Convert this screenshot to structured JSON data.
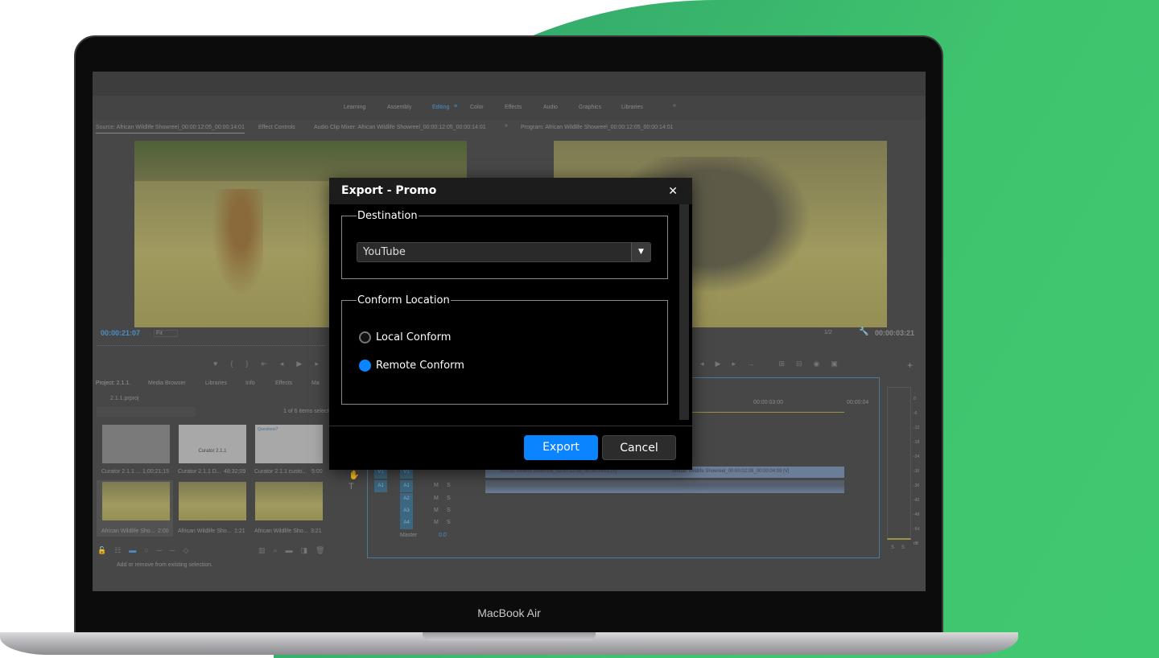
{
  "device_label": "MacBook Air",
  "workspaces": {
    "items": [
      "Learning",
      "Assembly",
      "Editing",
      "Color",
      "Effects",
      "Audio",
      "Graphics",
      "Libraries"
    ],
    "active": "Editing"
  },
  "source_panel": {
    "tabs": [
      "Source: African Wildlife Showreel_00:00:12:05_00:00:14:01",
      "Effect Controls",
      "Audio Clip Mixer: African Wildlife Showreel_00:00:12:05_00:00:14:01"
    ],
    "timecode": "00:00:21:07",
    "zoom": "Fit"
  },
  "program_panel": {
    "title": "Program: African Wildlife Showreel_00:00:12:05_00:00:14:01",
    "resolution": "1/2",
    "timecode": "00:00:03:21"
  },
  "project_panel": {
    "tabs": [
      "Project: 2.1.1.",
      "Media Browser",
      "Libraries",
      "Info",
      "Effects",
      "Ma"
    ],
    "project_file": "2.1.1.prproj",
    "selection_count": "1 of 6 items selected",
    "items": [
      {
        "name": "Curator 2.1.1 ...",
        "duration": "1;00;21;15"
      },
      {
        "name": "Curator 2.1.1 D...",
        "duration": "48;32;09",
        "thumb_text": "Curator 2.1.1"
      },
      {
        "name": "Curator 2.1.1 custo...",
        "duration": "5:00",
        "thumb_text": "Questions?"
      },
      {
        "name": "African Wildlife Sho...",
        "duration": "2:00"
      },
      {
        "name": "African Wildlife Sho...",
        "duration": "1:21"
      },
      {
        "name": "African Wildlife Sho...",
        "duration": "3:21"
      }
    ]
  },
  "timeline": {
    "ruler": [
      "00:00:03:00",
      "00:00:04"
    ],
    "clips": [
      "African Wildlife Showreel_00:00:12:05_00:00:14:01 [V]",
      "African Wildlife Showreel_00:00:02:09_00:00:04:09 [V]"
    ],
    "tracks": [
      {
        "src": "V1",
        "dst": "V1"
      },
      {
        "src": "A1",
        "dst": "A1"
      },
      {
        "src": "",
        "dst": "A2"
      },
      {
        "src": "",
        "dst": "A3"
      },
      {
        "src": "",
        "dst": "A4"
      }
    ],
    "mute": "M",
    "solo": "S",
    "master_label": "Master",
    "master_value": "0.0"
  },
  "audio_meter": {
    "scale": [
      "0",
      "-6",
      "-12",
      "-18",
      "-24",
      "-30",
      "-36",
      "-42",
      "-48",
      "-54",
      "dB"
    ],
    "solo": [
      "S",
      "S"
    ]
  },
  "status_bar": "Add or remove from existing selection.",
  "dialog": {
    "title": "Export - Promo",
    "destination_label": "Destination",
    "destination_value": "YouTube",
    "conform_label": "Conform Location",
    "options": [
      "Local Conform",
      "Remote Conform"
    ],
    "selected": "Remote Conform",
    "export_label": "Export",
    "cancel_label": "Cancel"
  },
  "colors": {
    "accent": "#0a84ff",
    "brand_green": "#3fc46e",
    "timecode_blue": "#4a8fc9"
  }
}
